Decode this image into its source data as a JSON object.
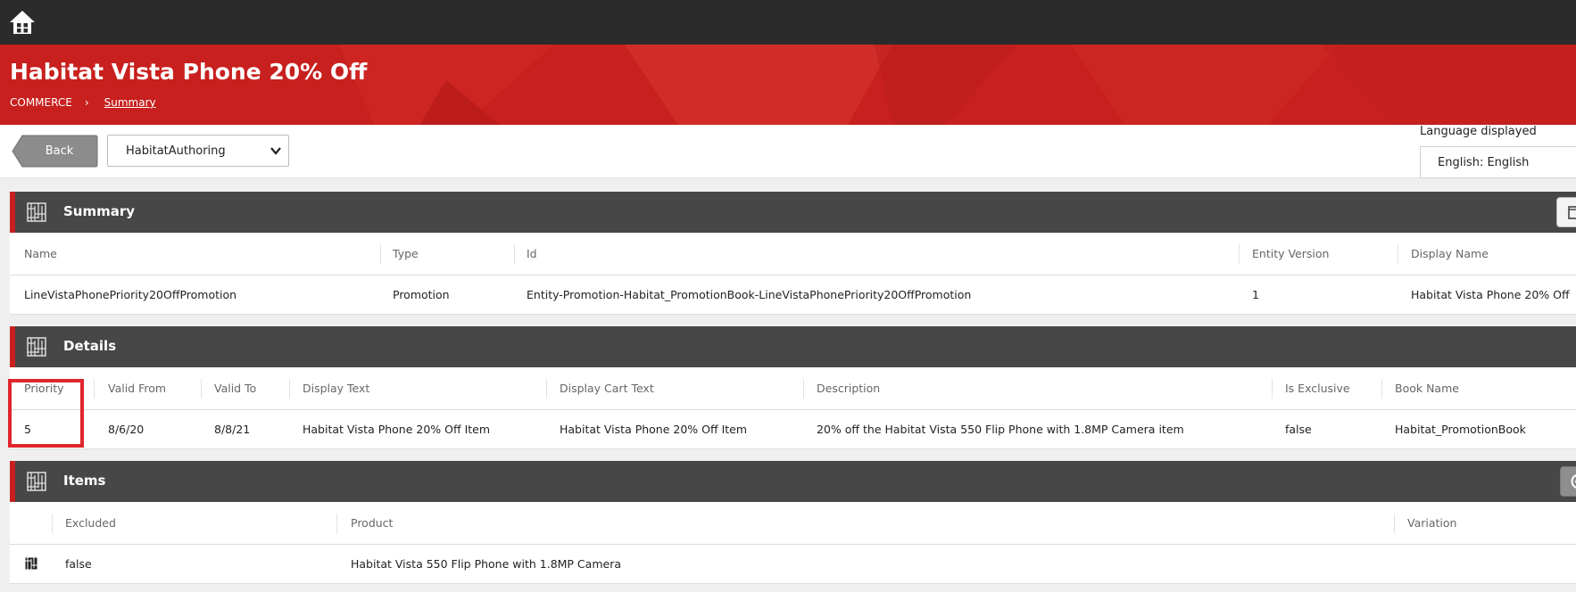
{
  "header": {
    "home_icon": "home-icon"
  },
  "banner": {
    "title": "Habitat Vista Phone 20% Off",
    "breadcrumb": [
      {
        "label": "COMMERCE"
      },
      {
        "label": "Summary"
      }
    ],
    "separator": "›",
    "color": "#c8201e"
  },
  "toolbar": {
    "back_label": "Back",
    "environment_select": "HabitatAuthoring",
    "language_label": "Language displayed",
    "language_value": "English: English"
  },
  "summary": {
    "title": "Summary",
    "columns": [
      "Name",
      "Type",
      "Id",
      "Entity Version",
      "Display Name"
    ],
    "row": [
      "LineVistaPhonePriority20OffPromotion",
      "Promotion",
      "Entity-Promotion-Habitat_PromotionBook-LineVistaPhonePriority20OffPromotion",
      "1",
      "Habitat Vista Phone 20% Off"
    ]
  },
  "details": {
    "title": "Details",
    "columns": [
      "Priority",
      "Valid From",
      "Valid To",
      "Display Text",
      "Display Cart Text",
      "Description",
      "Is Exclusive",
      "Book Name"
    ],
    "row": [
      "5",
      "8/6/20",
      "8/8/21",
      "Habitat Vista Phone 20% Off Item",
      "Habitat Vista Phone 20% Off Item",
      "20% off the Habitat Vista 550 Flip Phone with 1.8MP Camera item",
      "false",
      "Habitat_PromotionBook"
    ]
  },
  "items": {
    "title": "Items",
    "columns": [
      "Excluded",
      "Product",
      "Variation"
    ],
    "rows": [
      {
        "excluded": "false",
        "product": "Habitat Vista 550 Flip Phone with 1.8MP Camera",
        "variation": ""
      }
    ]
  },
  "annotation": {
    "highlight_color": "#e0252e"
  }
}
